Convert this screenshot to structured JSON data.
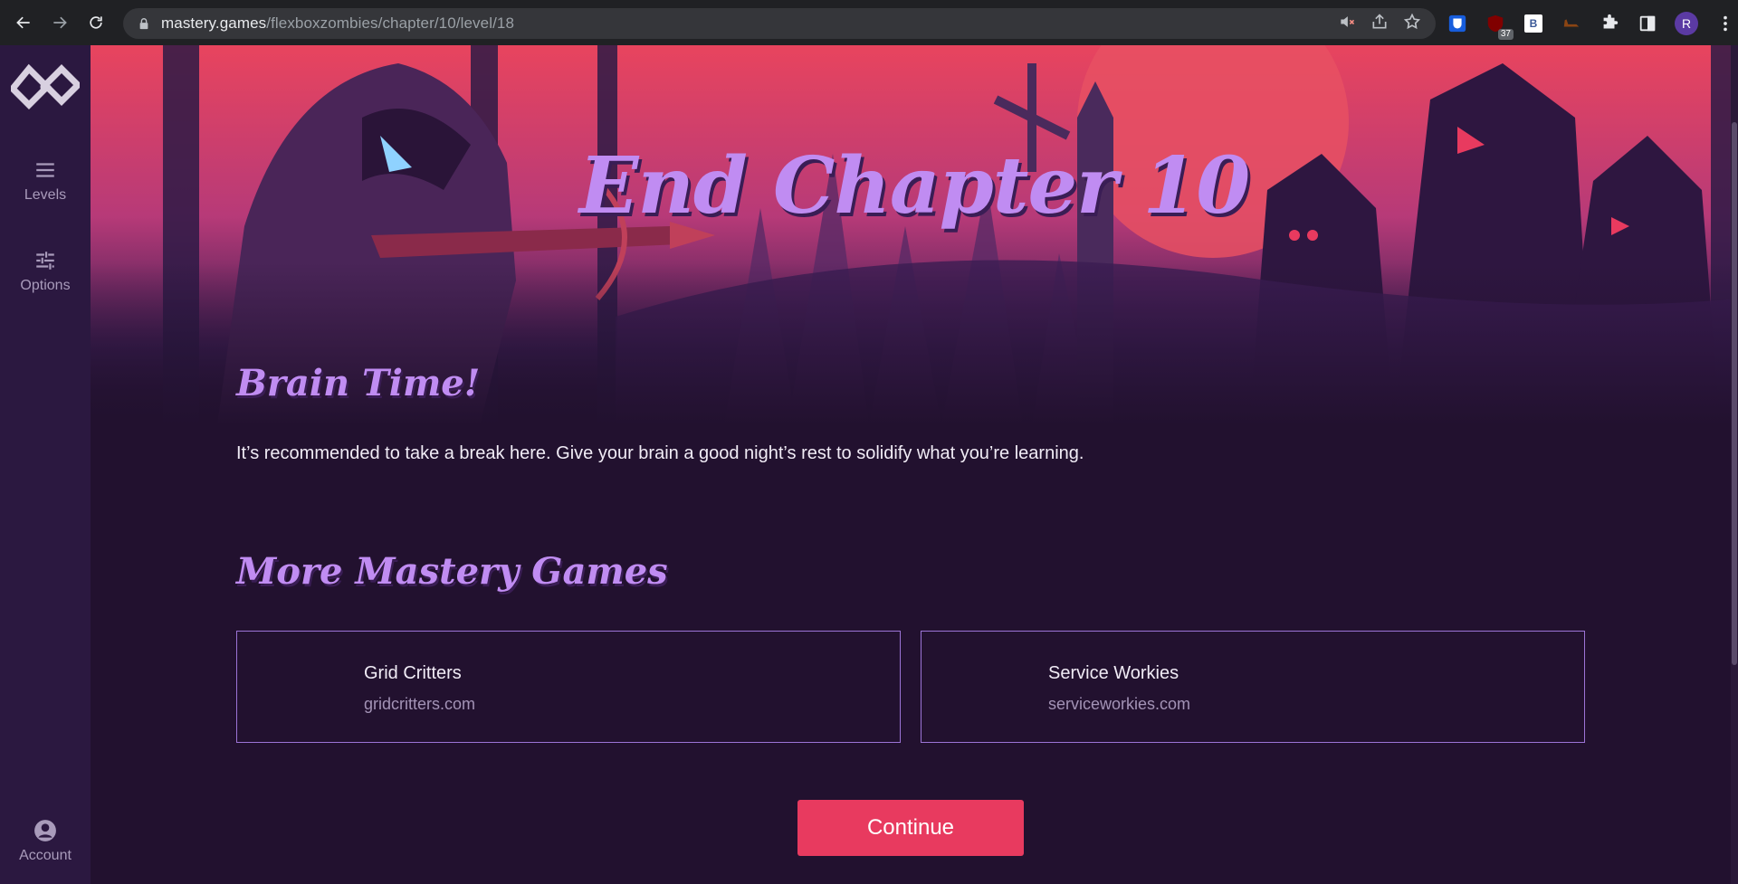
{
  "browser": {
    "url_host": "mastery.games",
    "url_path": "/flexboxzombies/chapter/10/level/18",
    "ext_badge": "37",
    "ext_b_label": "B",
    "profile_initial": "R"
  },
  "sidebar": {
    "levels_label": "Levels",
    "options_label": "Options",
    "account_label": "Account"
  },
  "hero": {
    "title": "End Chapter 10"
  },
  "brain": {
    "heading": "Brain Time!",
    "text": "It’s recommended to take a break here. Give your brain a good night’s rest to solidify what you’re learning."
  },
  "more_games": {
    "heading": "More Mastery Games",
    "cards": [
      {
        "name": "Grid Critters",
        "domain": "gridcritters.com"
      },
      {
        "name": "Service Workies",
        "domain": "serviceworkies.com"
      }
    ]
  },
  "continue_label": "Continue",
  "colors": {
    "accent": "#c08cf2",
    "button": "#e83a5f",
    "background": "#22112f",
    "card_border": "#9c74d6"
  }
}
